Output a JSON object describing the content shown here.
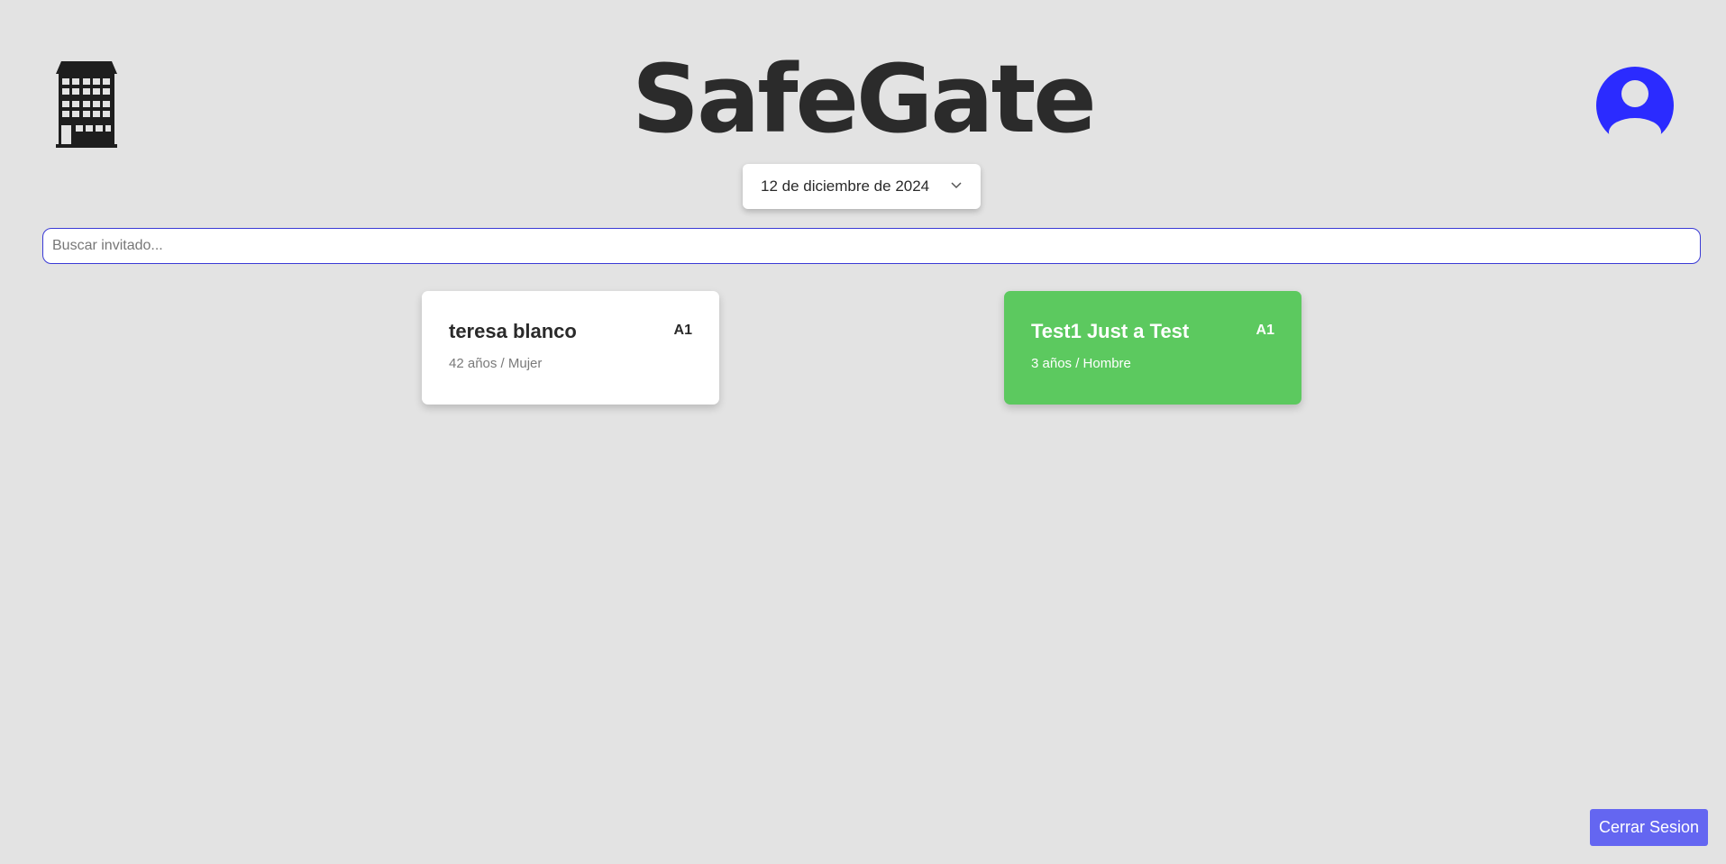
{
  "header": {
    "title": "SafeGate",
    "logo_icon": "building-icon",
    "profile_icon": "user-avatar-icon",
    "profile_color": "#2b2bff"
  },
  "date_select": {
    "selected": "12 de diciembre de 2024",
    "icon": "chevron-down-icon"
  },
  "search": {
    "placeholder": "Buscar invitado...",
    "value": ""
  },
  "guests": [
    {
      "name": "teresa blanco",
      "details": "42 años / Mujer",
      "unit": "A1",
      "color": "#ffffff"
    },
    {
      "name": "Test1 Just a Test",
      "details": "3 años / Hombre",
      "unit": "A1",
      "color": "#5cc95f"
    }
  ],
  "footer": {
    "logout_label": "Cerrar Sesion",
    "logout_color": "#6466f1"
  }
}
